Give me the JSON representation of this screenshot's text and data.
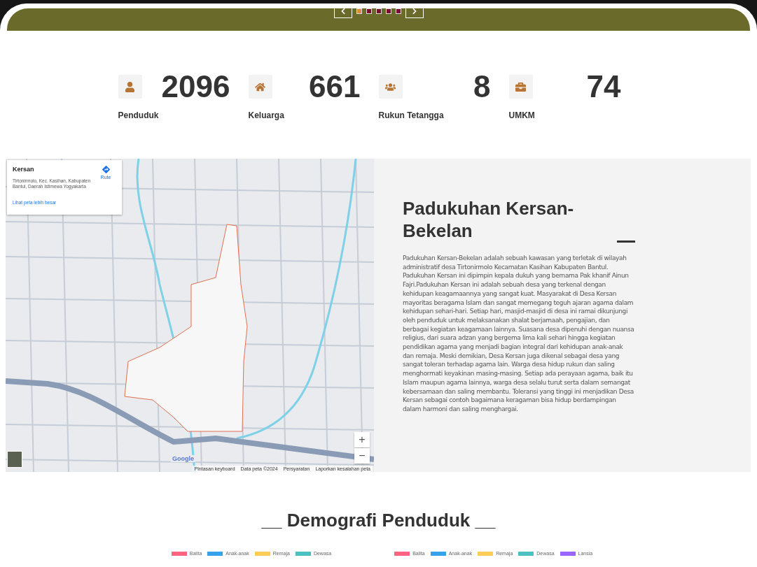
{
  "carousel": {
    "indicators": [
      {
        "selected": true
      },
      {
        "selected": false
      },
      {
        "selected": false
      },
      {
        "selected": false
      },
      {
        "selected": false
      }
    ]
  },
  "stats": [
    {
      "kind": "person",
      "value": "2096",
      "label": "Penduduk"
    },
    {
      "kind": "house",
      "value": "661",
      "label": "Keluarga"
    },
    {
      "kind": "group",
      "value": "8",
      "label": "Rukun Tetangga"
    },
    {
      "kind": "briefcase",
      "value": "74",
      "label": "UMKM"
    }
  ],
  "map": {
    "card": {
      "title": "Kersan",
      "address": "Tirtonirmolo, Kec. Kasihan, Kabupaten Bantul, Daerah Istimewa Yogyakarta",
      "link": "Lihat peta lebih besar",
      "route": "Rute"
    },
    "zoom": [
      "+",
      "−"
    ],
    "logo": "Google",
    "attribution": [
      "Pintasan keyboard",
      "Data peta ©2024",
      "Persyaratan",
      "Laporkan kesalahan peta"
    ]
  },
  "about": {
    "title": "Padukuhan Kersan-Bekelan",
    "text": "Padukuhan Kersan-Bekelan adalah sebuah kawasan yang terletak di wilayah administratif desa Tirtonirmolo Kecamatan Kasihan Kabupaten Bantul. Padukuhan Kersan ini dipimpin kepala dukuh yang bernama Pak khanif Ainun Fajri.Padukuhan Kersan ini adalah sebuah desa yang terkenal dengan kehidupan keagamaannya yang sangat kuat. Masyarakat di Desa Kersan mayoritas beragama Islam dan sangat memegang teguh ajaran agama dalam kehidupan sehari-hari. Setiap hari, masjid-masjid di desa ini ramai dikunjungi oleh penduduk untuk melaksanakan shalat berjamaah, pengajian, dan berbagai kegiatan keagamaan lainnya. Suasana desa dipenuhi dengan nuansa religius, dari suara adzan yang bergema lima kali sehari hingga kegiatan pendidikan agama yang menjadi bagian integral dari kehidupan anak-anak dan remaja. Meski demikian, Desa Kersan juga dikenal sebagai desa yang sangat toleran terhadap agama lain. Warga desa hidup rukun dan saling menghormati keyakinan masing-masing. Setiap ada perayaan agama, baik itu Islam maupun agama lainnya, warga desa selalu turut serta dalam semangat kebersamaan dan saling membantu. Toleransi yang tinggi ini menjadikan Desa Kersan sebagai contoh bagaimana keragaman bisa hidup berdampingan dalam harmoni dan saling menghargai."
  },
  "demografi": {
    "title": "__ Demografi Penduduk __",
    "legends": [
      [
        {
          "label": "Balita",
          "color": "#ff6384"
        },
        {
          "label": "Anak-anak",
          "color": "#36a2eb"
        },
        {
          "label": "Remaja",
          "color": "#ffcd56"
        },
        {
          "label": "Dewasa",
          "color": "#4bc0c0"
        }
      ],
      [
        {
          "label": "Balita",
          "color": "#ff6384"
        },
        {
          "label": "Anak-anak",
          "color": "#36a2eb"
        },
        {
          "label": "Remaja",
          "color": "#ffcd56"
        },
        {
          "label": "Dewasa",
          "color": "#4bc0c0"
        },
        {
          "label": "Lansia",
          "color": "#9966ff"
        }
      ]
    ]
  }
}
